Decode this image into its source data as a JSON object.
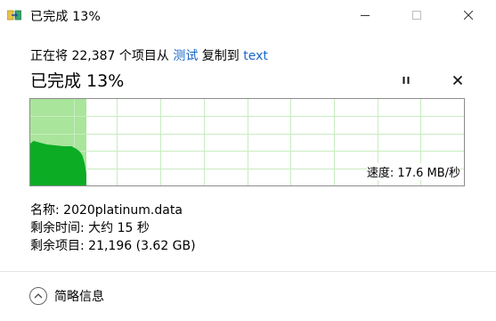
{
  "window": {
    "title": "已完成 13%",
    "icon": "copy-progress-icon",
    "controls": [
      "minimize-icon",
      "maximize-icon",
      "close-icon"
    ]
  },
  "copy_info": {
    "prefix": "正在将 22,387 个项目从 ",
    "source": "测试",
    "middle": " 复制到 ",
    "destination": "text"
  },
  "status": {
    "text": "已完成 13%",
    "percent": 13,
    "pause_icon": "pause-icon",
    "cancel_icon": "cancel-icon"
  },
  "speed": {
    "label": "速度: 17.6 MB/秒"
  },
  "details": {
    "name": "名称: 2020platinum.data",
    "time_remaining": "剩余时间: 大约 15 秒",
    "items_remaining": "剩余项目: 21,196 (3.62 GB)"
  },
  "footer": {
    "toggle_label": "简略信息",
    "toggle_icon": "chevron-up-icon"
  },
  "colors": {
    "progress_fill": "#a9e59b",
    "speed_fill": "#0cac25",
    "grid": "#c8ecc0",
    "link": "#1a66c9"
  }
}
